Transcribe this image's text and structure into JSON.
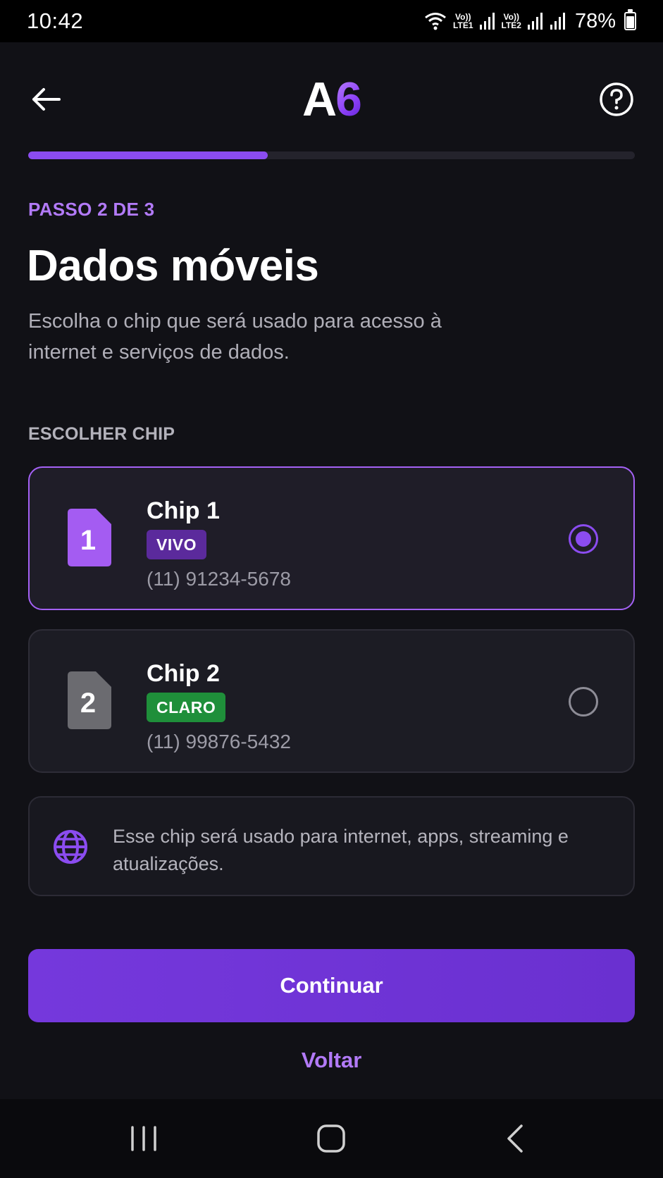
{
  "status_bar": {
    "time": "10:42",
    "sim1_label_top": "Vo))",
    "sim1_label_bottom": "LTE1",
    "sim2_label_top": "Vo))",
    "sim2_label_bottom": "LTE2",
    "battery_percent": "78%",
    "battery_level": 0.78
  },
  "header": {
    "logo_letter": "A",
    "logo_digit": "6",
    "back_icon": "arrow-left-icon",
    "help_icon": "help-circle-icon"
  },
  "progress": {
    "current_step": 2,
    "total_steps": 3,
    "fraction": 0.395
  },
  "step_label": "PASSO 2 DE 3",
  "title": "Dados móveis",
  "subtitle": "Escolha o chip que será usado para acesso à internet e serviços de dados.",
  "section_label": "ESCOLHER CHIP",
  "chips": [
    {
      "slot": "1",
      "name": "Chip 1",
      "carrier": "VIVO",
      "carrier_color": "#5b2a9c",
      "number": "(11) 91234-5678",
      "icon_color": "#a45cf2",
      "selected": true
    },
    {
      "slot": "2",
      "name": "Chip 2",
      "carrier": "CLARO",
      "carrier_color": "#1f8f3a",
      "number": "(11) 99876-5432",
      "icon_color": "#6b6b70",
      "selected": false
    }
  ],
  "info": {
    "icon": "globe-icon",
    "text": "Esse chip será usado para internet, apps, streaming e atualizações."
  },
  "buttons": {
    "continue_label": "Continuar",
    "back_label": "Voltar"
  },
  "colors": {
    "accent": "#8b4cf0",
    "accent_text": "#b27af7",
    "background": "#111116"
  },
  "nav_bar": {
    "recent_icon": "recent-apps-icon",
    "home_icon": "home-icon",
    "back_icon": "nav-back-icon"
  }
}
